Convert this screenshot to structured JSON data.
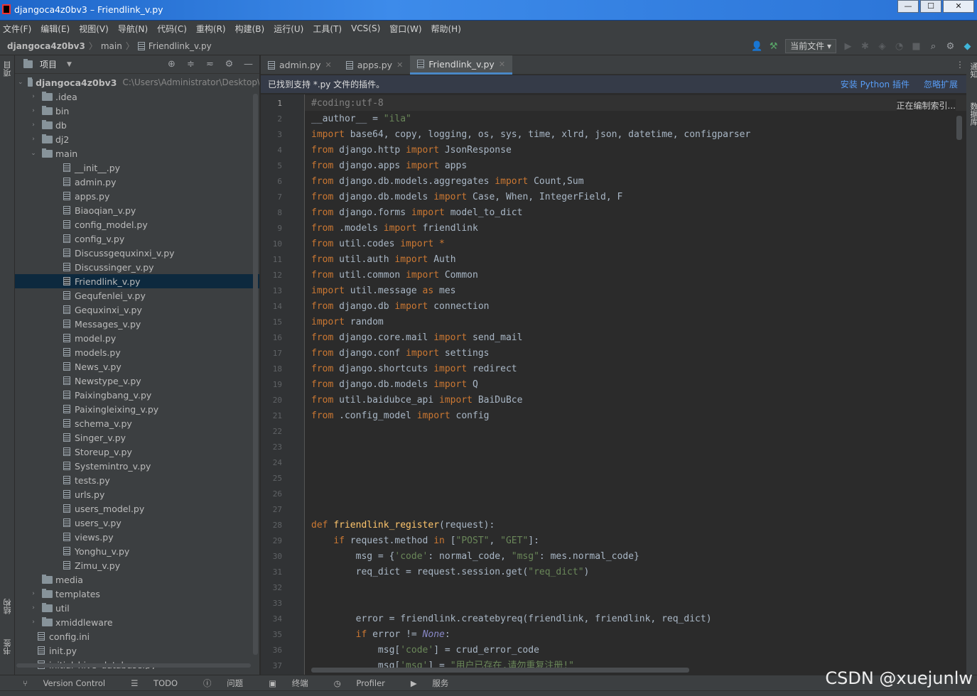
{
  "window": {
    "title": "djangoca4z0bv3 – Friendlink_v.py",
    "min": "—",
    "max": "☐",
    "close": "✕"
  },
  "menu": [
    "文件(F)",
    "编辑(E)",
    "视图(V)",
    "导航(N)",
    "代码(C)",
    "重构(R)",
    "构建(B)",
    "运行(U)",
    "工具(T)",
    "VCS(S)",
    "窗口(W)",
    "帮助(H)"
  ],
  "breadcrumb": {
    "project": "djangoca4z0bv3",
    "folder": "main",
    "file": "Friendlink_v.py"
  },
  "toolbar": {
    "run_config": "当前文件"
  },
  "side_tabs": {
    "project": "项目",
    "structure": "结构",
    "bookmarks": "书签",
    "right_notifications": "通知",
    "right_database": "数据库"
  },
  "project_panel": {
    "title": "项目",
    "root": {
      "name": "djangoca4z0bv3",
      "path": "C:\\Users\\Administrator\\Desktop\\"
    },
    "tree": [
      {
        "name": ".idea",
        "type": "folder",
        "depth": 1,
        "arrow": "›"
      },
      {
        "name": "bin",
        "type": "folder",
        "depth": 1,
        "arrow": "›"
      },
      {
        "name": "db",
        "type": "folder",
        "depth": 1,
        "arrow": "›"
      },
      {
        "name": "dj2",
        "type": "folder",
        "depth": 1,
        "arrow": "›"
      },
      {
        "name": "main",
        "type": "folder",
        "depth": 1,
        "arrow": "⌄"
      },
      {
        "name": "__init__.py",
        "type": "file",
        "depth": 2
      },
      {
        "name": "admin.py",
        "type": "file",
        "depth": 2
      },
      {
        "name": "apps.py",
        "type": "file",
        "depth": 2
      },
      {
        "name": "Biaoqian_v.py",
        "type": "file",
        "depth": 2
      },
      {
        "name": "config_model.py",
        "type": "file",
        "depth": 2
      },
      {
        "name": "config_v.py",
        "type": "file",
        "depth": 2
      },
      {
        "name": "Discussgequxinxi_v.py",
        "type": "file",
        "depth": 2
      },
      {
        "name": "Discussinger_v.py",
        "type": "file",
        "depth": 2
      },
      {
        "name": "Friendlink_v.py",
        "type": "file",
        "depth": 2,
        "selected": true
      },
      {
        "name": "Gequfenlei_v.py",
        "type": "file",
        "depth": 2
      },
      {
        "name": "Gequxinxi_v.py",
        "type": "file",
        "depth": 2
      },
      {
        "name": "Messages_v.py",
        "type": "file",
        "depth": 2
      },
      {
        "name": "model.py",
        "type": "file",
        "depth": 2
      },
      {
        "name": "models.py",
        "type": "file",
        "depth": 2
      },
      {
        "name": "News_v.py",
        "type": "file",
        "depth": 2
      },
      {
        "name": "Newstype_v.py",
        "type": "file",
        "depth": 2
      },
      {
        "name": "Paixingbang_v.py",
        "type": "file",
        "depth": 2
      },
      {
        "name": "Paixingleixing_v.py",
        "type": "file",
        "depth": 2
      },
      {
        "name": "schema_v.py",
        "type": "file",
        "depth": 2
      },
      {
        "name": "Singer_v.py",
        "type": "file",
        "depth": 2
      },
      {
        "name": "Storeup_v.py",
        "type": "file",
        "depth": 2
      },
      {
        "name": "Systemintro_v.py",
        "type": "file",
        "depth": 2
      },
      {
        "name": "tests.py",
        "type": "file",
        "depth": 2
      },
      {
        "name": "urls.py",
        "type": "file",
        "depth": 2
      },
      {
        "name": "users_model.py",
        "type": "file",
        "depth": 2
      },
      {
        "name": "users_v.py",
        "type": "file",
        "depth": 2
      },
      {
        "name": "views.py",
        "type": "file",
        "depth": 2
      },
      {
        "name": "Yonghu_v.py",
        "type": "file",
        "depth": 2
      },
      {
        "name": "Zimu_v.py",
        "type": "file",
        "depth": 2
      },
      {
        "name": "media",
        "type": "folder",
        "depth": 1,
        "arrow": ""
      },
      {
        "name": "templates",
        "type": "folder",
        "depth": 1,
        "arrow": "›"
      },
      {
        "name": "util",
        "type": "folder",
        "depth": 1,
        "arrow": "›"
      },
      {
        "name": "xmiddleware",
        "type": "folder",
        "depth": 1,
        "arrow": "›"
      },
      {
        "name": "config.ini",
        "type": "file",
        "depth": 1
      },
      {
        "name": "init.py",
        "type": "file",
        "depth": 1
      },
      {
        "name": "initial_hive_database.py",
        "type": "file",
        "depth": 1
      }
    ]
  },
  "editor_tabs": [
    {
      "label": "admin.py",
      "active": false
    },
    {
      "label": "apps.py",
      "active": false
    },
    {
      "label": "Friendlink_v.py",
      "active": true
    }
  ],
  "plugin_banner": {
    "message": "已找到支持 *.py 文件的插件。",
    "install": "安装 Python 插件",
    "ignore": "忽略扩展"
  },
  "indexing_label": "正在编制索引...",
  "code_lines": [
    {
      "n": "1",
      "t": [
        [
          "c",
          "#coding:utf-8"
        ]
      ]
    },
    {
      "n": "2",
      "t": [
        [
          "",
          "__author__ = "
        ],
        [
          "s",
          "\"ila\""
        ]
      ]
    },
    {
      "n": "3",
      "t": [
        [
          "k",
          "import "
        ],
        [
          "",
          "base64, copy, logging, os, sys, time, xlrd, json, datetime, configparser"
        ]
      ]
    },
    {
      "n": "4",
      "t": [
        [
          "k",
          "from "
        ],
        [
          "",
          "django.http "
        ],
        [
          "k",
          "import "
        ],
        [
          "",
          "JsonResponse"
        ]
      ]
    },
    {
      "n": "5",
      "t": [
        [
          "k",
          "from "
        ],
        [
          "",
          "django.apps "
        ],
        [
          "k",
          "import "
        ],
        [
          "",
          "apps"
        ]
      ]
    },
    {
      "n": "6",
      "t": [
        [
          "k",
          "from "
        ],
        [
          "",
          "django.db.models.aggregates "
        ],
        [
          "k",
          "import "
        ],
        [
          "",
          "Count,Sum"
        ]
      ]
    },
    {
      "n": "7",
      "t": [
        [
          "k",
          "from "
        ],
        [
          "",
          "django.db.models "
        ],
        [
          "k",
          "import "
        ],
        [
          "",
          "Case, When, IntegerField, F"
        ]
      ]
    },
    {
      "n": "8",
      "t": [
        [
          "k",
          "from "
        ],
        [
          "",
          "django.forms "
        ],
        [
          "k",
          "import "
        ],
        [
          "",
          "model_to_dict"
        ]
      ]
    },
    {
      "n": "9",
      "t": [
        [
          "k",
          "from "
        ],
        [
          "",
          ".models "
        ],
        [
          "k",
          "import "
        ],
        [
          "",
          "friendlink"
        ]
      ]
    },
    {
      "n": "10",
      "t": [
        [
          "k",
          "from "
        ],
        [
          "",
          "util.codes "
        ],
        [
          "k",
          "import *"
        ]
      ]
    },
    {
      "n": "11",
      "t": [
        [
          "k",
          "from "
        ],
        [
          "",
          "util.auth "
        ],
        [
          "k",
          "import "
        ],
        [
          "",
          "Auth"
        ]
      ]
    },
    {
      "n": "12",
      "t": [
        [
          "k",
          "from "
        ],
        [
          "",
          "util.common "
        ],
        [
          "k",
          "import "
        ],
        [
          "",
          "Common"
        ]
      ]
    },
    {
      "n": "13",
      "t": [
        [
          "k",
          "import "
        ],
        [
          "",
          "util.message "
        ],
        [
          "k",
          "as "
        ],
        [
          "",
          "mes"
        ]
      ]
    },
    {
      "n": "14",
      "t": [
        [
          "k",
          "from "
        ],
        [
          "",
          "django.db "
        ],
        [
          "k",
          "import "
        ],
        [
          "",
          "connection"
        ]
      ]
    },
    {
      "n": "15",
      "t": [
        [
          "k",
          "import "
        ],
        [
          "",
          "random"
        ]
      ]
    },
    {
      "n": "16",
      "t": [
        [
          "k",
          "from "
        ],
        [
          "",
          "django.core.mail "
        ],
        [
          "k",
          "import "
        ],
        [
          "",
          "send_mail"
        ]
      ]
    },
    {
      "n": "17",
      "t": [
        [
          "k",
          "from "
        ],
        [
          "",
          "django.conf "
        ],
        [
          "k",
          "import "
        ],
        [
          "",
          "settings"
        ]
      ]
    },
    {
      "n": "18",
      "t": [
        [
          "k",
          "from "
        ],
        [
          "",
          "django.shortcuts "
        ],
        [
          "k",
          "import "
        ],
        [
          "",
          "redirect"
        ]
      ]
    },
    {
      "n": "19",
      "t": [
        [
          "k",
          "from "
        ],
        [
          "",
          "django.db.models "
        ],
        [
          "k",
          "import "
        ],
        [
          "",
          "Q"
        ]
      ]
    },
    {
      "n": "20",
      "t": [
        [
          "k",
          "from "
        ],
        [
          "",
          "util.baidubce_api "
        ],
        [
          "k",
          "import "
        ],
        [
          "",
          "BaiDuBce"
        ]
      ]
    },
    {
      "n": "21",
      "t": [
        [
          "k",
          "from "
        ],
        [
          "",
          ".config_model "
        ],
        [
          "k",
          "import "
        ],
        [
          "",
          "config"
        ]
      ]
    },
    {
      "n": "22",
      "t": []
    },
    {
      "n": "23",
      "t": []
    },
    {
      "n": "24",
      "t": []
    },
    {
      "n": "25",
      "t": []
    },
    {
      "n": "26",
      "t": []
    },
    {
      "n": "27",
      "t": []
    },
    {
      "n": "28",
      "t": [
        [
          "k",
          "def "
        ],
        [
          "f",
          "friendlink_register"
        ],
        [
          "",
          "(request):"
        ]
      ]
    },
    {
      "n": "29",
      "t": [
        [
          "",
          "    "
        ],
        [
          "k",
          "if "
        ],
        [
          "",
          "request.method "
        ],
        [
          "k",
          "in "
        ],
        [
          "",
          "["
        ],
        [
          "s",
          "\"POST\""
        ],
        [
          "",
          ", "
        ],
        [
          "s",
          "\"GET\""
        ],
        [
          "",
          "]:"
        ]
      ]
    },
    {
      "n": "30",
      "t": [
        [
          "",
          "        msg = {"
        ],
        [
          "s",
          "'code'"
        ],
        [
          "",
          ": normal_code, "
        ],
        [
          "s",
          "\"msg\""
        ],
        [
          "",
          ": mes.normal_code}"
        ]
      ]
    },
    {
      "n": "31",
      "t": [
        [
          "",
          "        req_dict = request.session.get("
        ],
        [
          "s",
          "\"req_dict\""
        ],
        [
          "",
          ")"
        ]
      ]
    },
    {
      "n": "32",
      "t": []
    },
    {
      "n": "33",
      "t": []
    },
    {
      "n": "34",
      "t": [
        [
          "",
          "        error = friendlink.createbyreq(friendlink, friendlink, req_dict)"
        ]
      ]
    },
    {
      "n": "35",
      "t": [
        [
          "",
          "        "
        ],
        [
          "k",
          "if "
        ],
        [
          "",
          "error != "
        ],
        [
          "it",
          "None"
        ],
        [
          "",
          ":"
        ]
      ]
    },
    {
      "n": "36",
      "t": [
        [
          "",
          "            msg["
        ],
        [
          "s",
          "'code'"
        ],
        [
          "",
          "] = crud_error_code"
        ]
      ]
    },
    {
      "n": "37",
      "t": [
        [
          "",
          "            msg["
        ],
        [
          "s",
          "'msg'"
        ],
        [
          "",
          "] = "
        ],
        [
          "s",
          "\"用户已存在,请勿重复注册!\""
        ]
      ]
    }
  ],
  "bottom_tools": [
    "Version Control",
    "TODO",
    "问题",
    "终端",
    "Profiler",
    "服务"
  ],
  "watermark": "CSDN @xuejunlw"
}
